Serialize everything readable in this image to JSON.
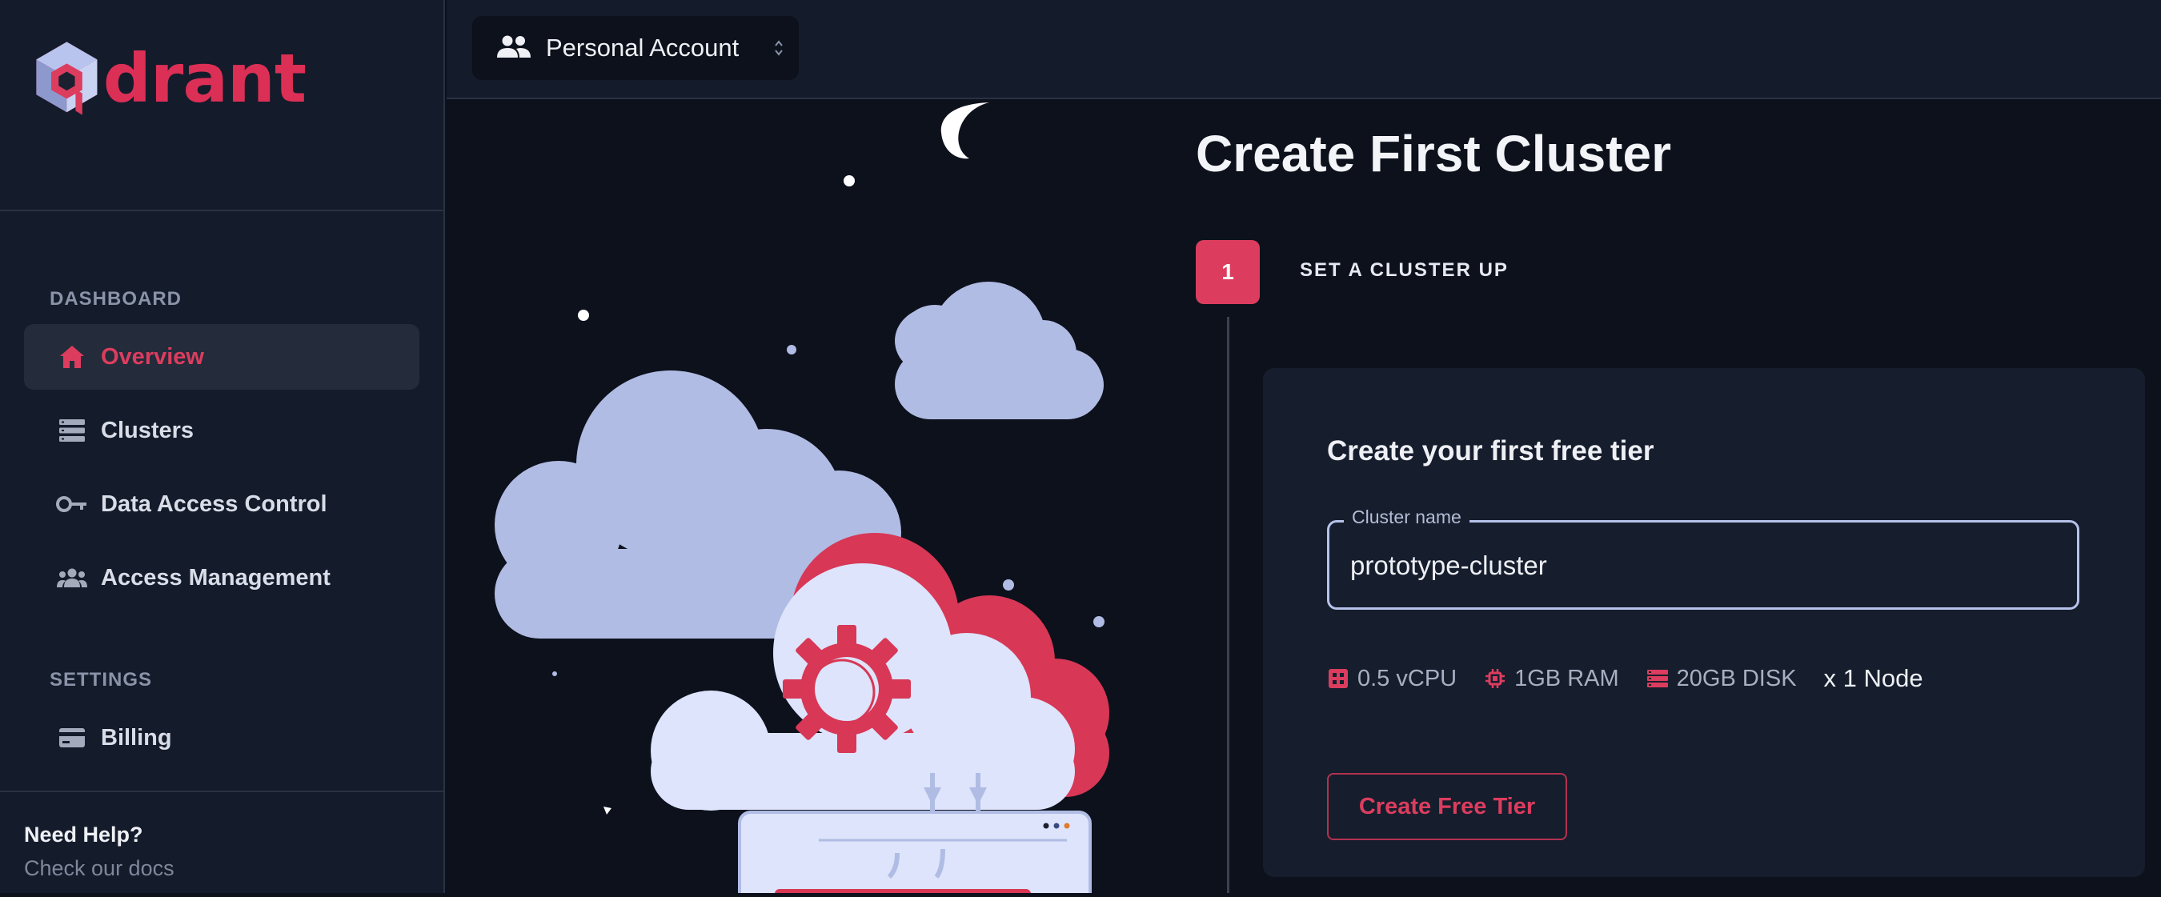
{
  "app": {
    "brand_text": "drant"
  },
  "sidebar": {
    "sections": [
      {
        "label": "DASHBOARD"
      },
      {
        "label": "SETTINGS"
      }
    ],
    "items": [
      {
        "label": "Overview",
        "icon": "home-icon",
        "active": true
      },
      {
        "label": "Clusters",
        "icon": "clusters-icon",
        "active": false
      },
      {
        "label": "Data Access Control",
        "icon": "key-icon",
        "active": false
      },
      {
        "label": "Access Management",
        "icon": "people-icon",
        "active": false
      },
      {
        "label": "Billing",
        "icon": "credit-card-icon",
        "active": false
      }
    ],
    "help": {
      "title": "Need Help?",
      "link": "Check our docs"
    }
  },
  "topbar": {
    "account": {
      "label": "Personal Account",
      "icon": "people-icon"
    }
  },
  "main": {
    "title": "Create First Cluster",
    "step": {
      "number": "1",
      "label": "SET A CLUSTER UP"
    },
    "card": {
      "title": "Create your first free tier",
      "field": {
        "legend": "Cluster name",
        "value": "prototype-cluster"
      },
      "specs": [
        {
          "icon": "cpu-box-icon",
          "text": "0.5 vCPU"
        },
        {
          "icon": "chip-icon",
          "text": "1GB RAM"
        },
        {
          "icon": "storage-icon",
          "text": "20GB DISK"
        }
      ],
      "nodes": "x 1 Node",
      "button": "Create Free Tier"
    }
  },
  "colors": {
    "accent": "#dc3d5e",
    "sidebar_bg": "#141b2b",
    "page_bg": "#0d111c",
    "card_bg": "#161d2d",
    "cloud": "#b0bce3"
  }
}
